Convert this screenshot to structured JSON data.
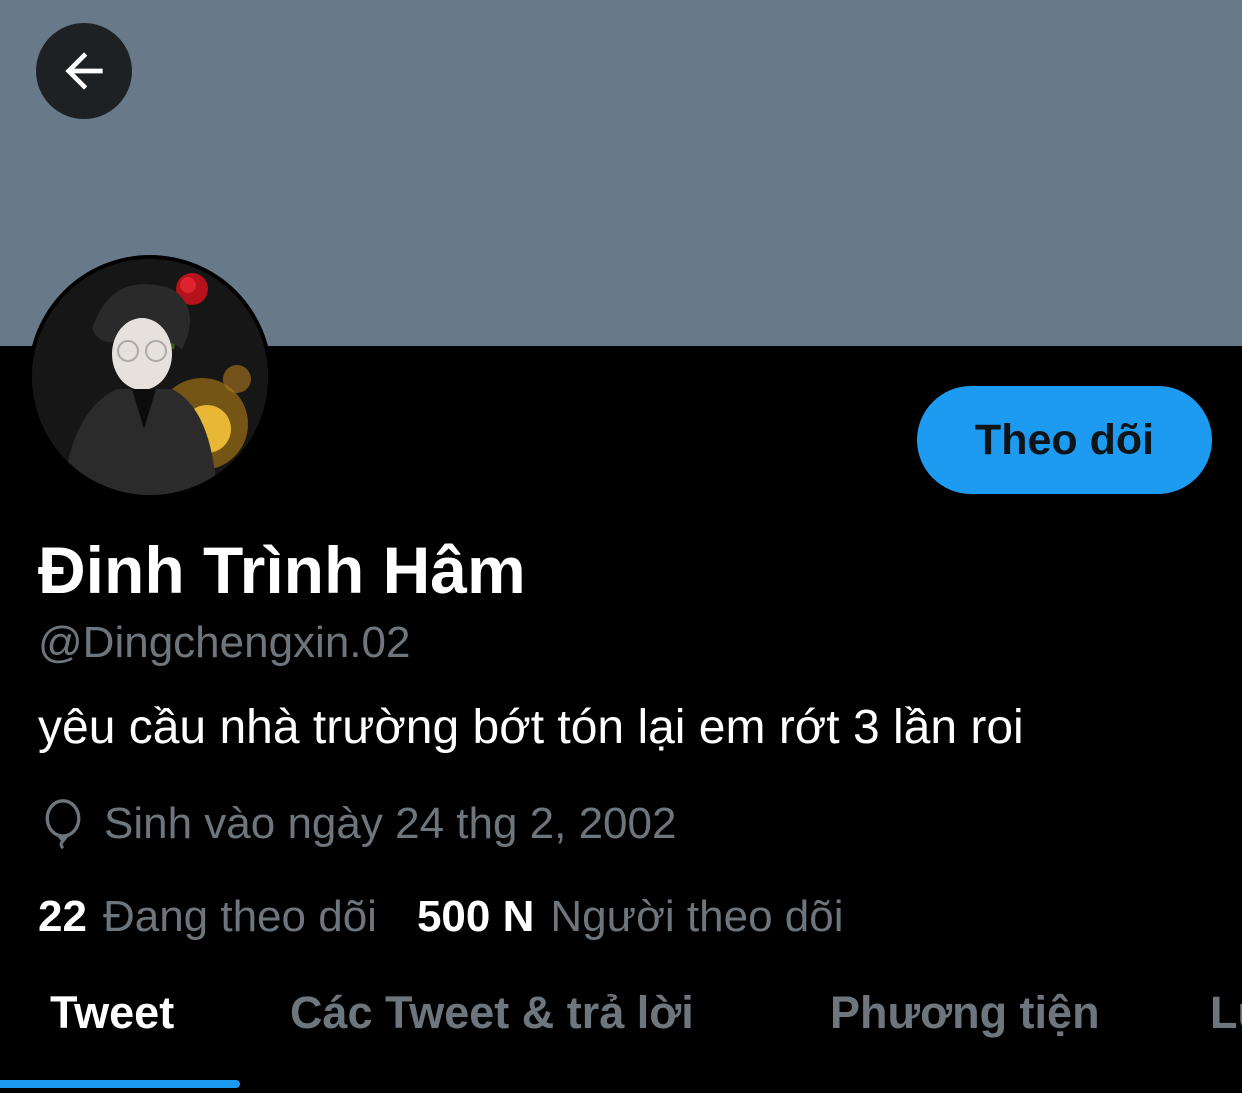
{
  "header": {
    "back_icon": "arrow-left-icon"
  },
  "profile": {
    "avatar_alt": "profile-photo",
    "follow_label": "Theo dõi",
    "display_name": "Đinh Trình Hâm",
    "handle": "@Dingchengxin.02",
    "bio": "yêu cầu nhà trường bớt tón lại em rớt 3 lần roi",
    "birthday_icon": "balloon-icon",
    "birthday": "Sinh vào ngày 24 thg 2, 2002"
  },
  "stats": {
    "following_count": "22",
    "following_label": "Đang theo dõi",
    "followers_count": "500 N",
    "followers_label": "Người theo dõi"
  },
  "tabs": [
    {
      "label": "Tweet",
      "active": true
    },
    {
      "label": "Các Tweet & trả lời",
      "active": false
    },
    {
      "label": "Phương tiện",
      "active": false
    },
    {
      "label": "Lư",
      "active": false
    }
  ],
  "colors": {
    "banner": "#687a8a",
    "accent": "#1d9bf0",
    "secondary_text": "#6e767d",
    "background": "#000000"
  }
}
